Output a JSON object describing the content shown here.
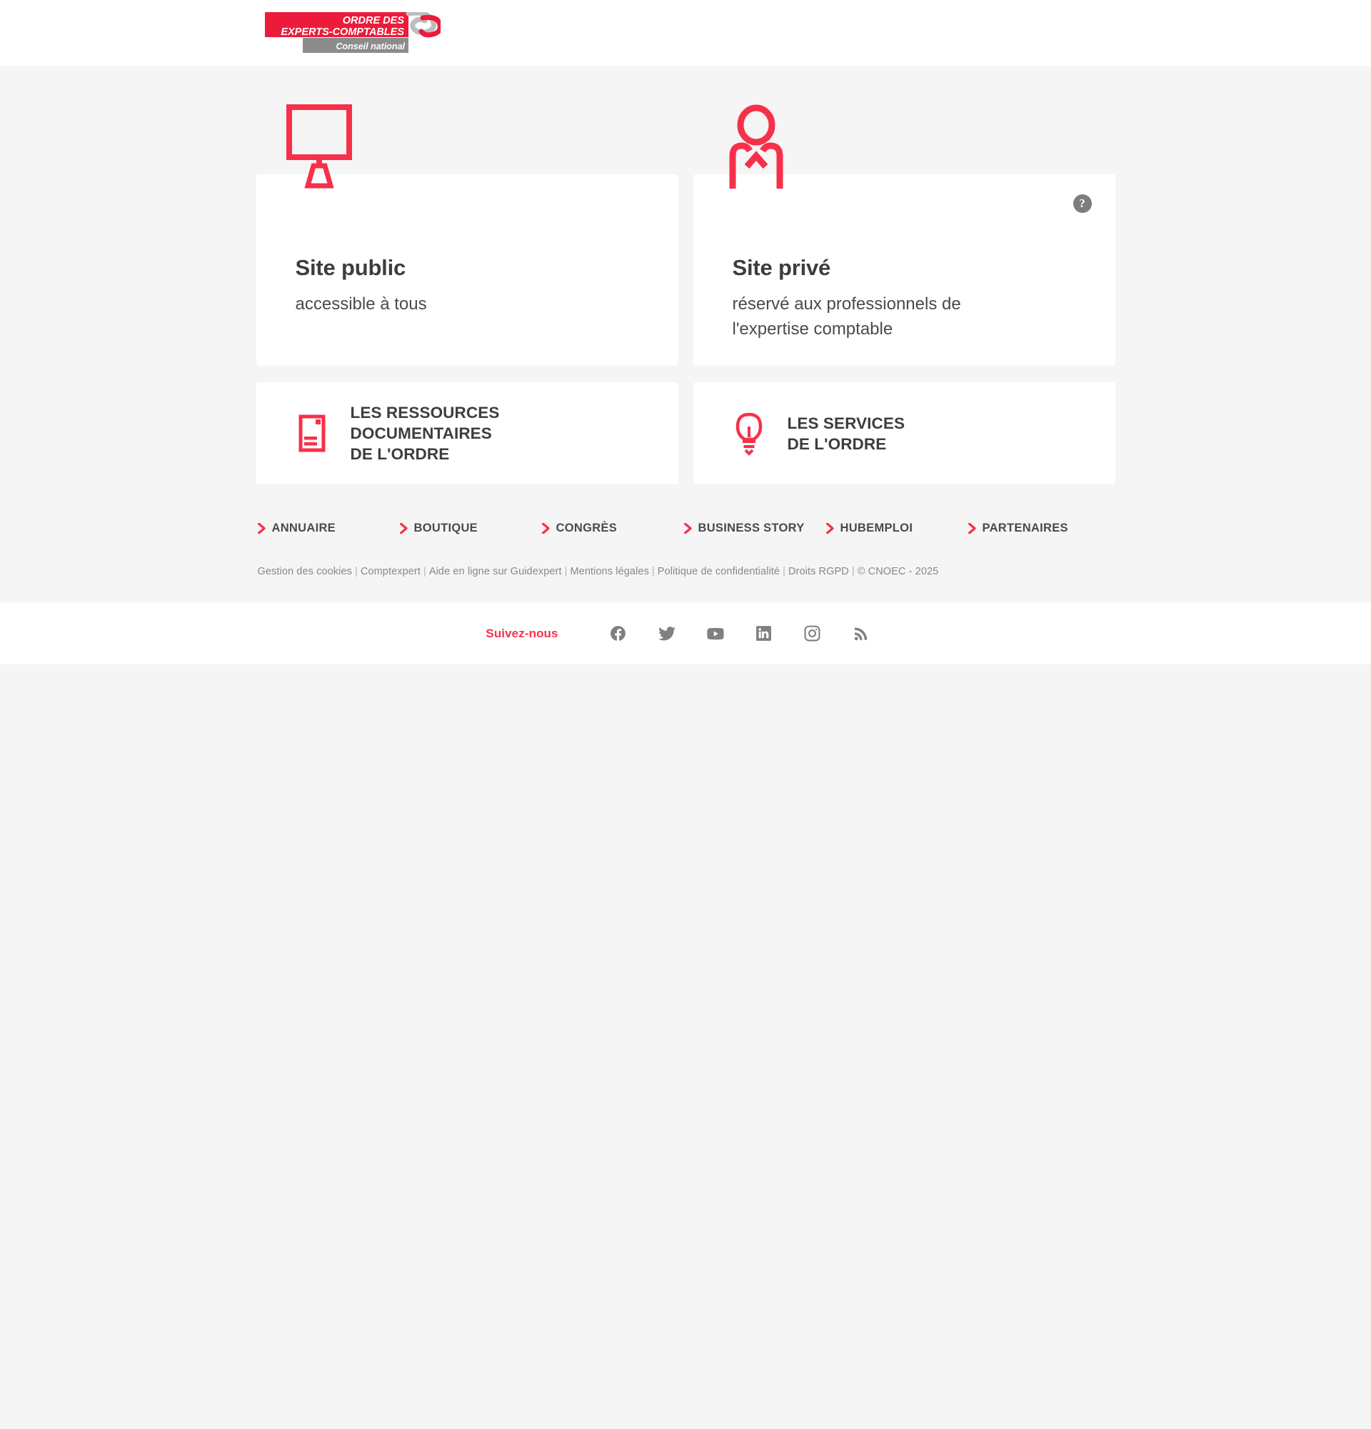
{
  "header": {
    "logo": {
      "name": "ordre-des-experts-comptables-logo",
      "line1": "ORDRE DES",
      "line2": "EXPERTS-COMPTABLES",
      "line3": "Conseil national"
    }
  },
  "colors": {
    "accent_red": "#f7304a",
    "page_background": "#f5f5f5",
    "card_background": "#ffffff",
    "heading_text": "#3d3d3d",
    "body_text": "#4a4a4a",
    "muted_text": "#888888",
    "help_badge_background": "#7d7d7d",
    "social_icon": "#808080"
  },
  "main": {
    "primary_cards": [
      {
        "icon": "desktop-monitor-icon",
        "title": "Site public",
        "subtitle": "accessible à tous",
        "has_help": false
      },
      {
        "icon": "person-user-icon",
        "title": "Site privé",
        "subtitle": "réservé aux professionnels de l'expertise comptable",
        "has_help": true,
        "help_label": "?"
      }
    ],
    "secondary_cards": [
      {
        "icon": "document-icon",
        "label": "LES RESSOURCES\nDOCUMENTAIRES\nDE L'ORDRE"
      },
      {
        "icon": "lightbulb-icon",
        "label": "LES SERVICES\nDE L'ORDRE"
      }
    ],
    "quick_links": [
      {
        "label": "ANNUAIRE",
        "icon": "chevron-right-icon"
      },
      {
        "label": "BOUTIQUE",
        "icon": "chevron-right-icon"
      },
      {
        "label": "CONGRÈS",
        "icon": "chevron-right-icon"
      },
      {
        "label": "BUSINESS STORY",
        "icon": "chevron-right-icon"
      },
      {
        "label": "HUBEMPLOI",
        "icon": "chevron-right-icon"
      },
      {
        "label": "PARTENAIRES",
        "icon": "chevron-right-icon"
      }
    ]
  },
  "footer": {
    "legal_links": [
      "Gestion des cookies",
      "Comptexpert",
      "Aide en ligne sur Guidexpert",
      "Mentions légales",
      "Politique de confidentialité",
      "Droits RGPD"
    ],
    "separator": "|",
    "copyright": "© CNOEC - 2025",
    "follow_label": "Suivez-nous",
    "social_icons": [
      {
        "name": "facebook-icon",
        "label": "Facebook"
      },
      {
        "name": "twitter-icon",
        "label": "Twitter"
      },
      {
        "name": "youtube-icon",
        "label": "YouTube"
      },
      {
        "name": "linkedin-icon",
        "label": "LinkedIn"
      },
      {
        "name": "instagram-icon",
        "label": "Instagram"
      },
      {
        "name": "rss-icon",
        "label": "RSS"
      }
    ]
  }
}
